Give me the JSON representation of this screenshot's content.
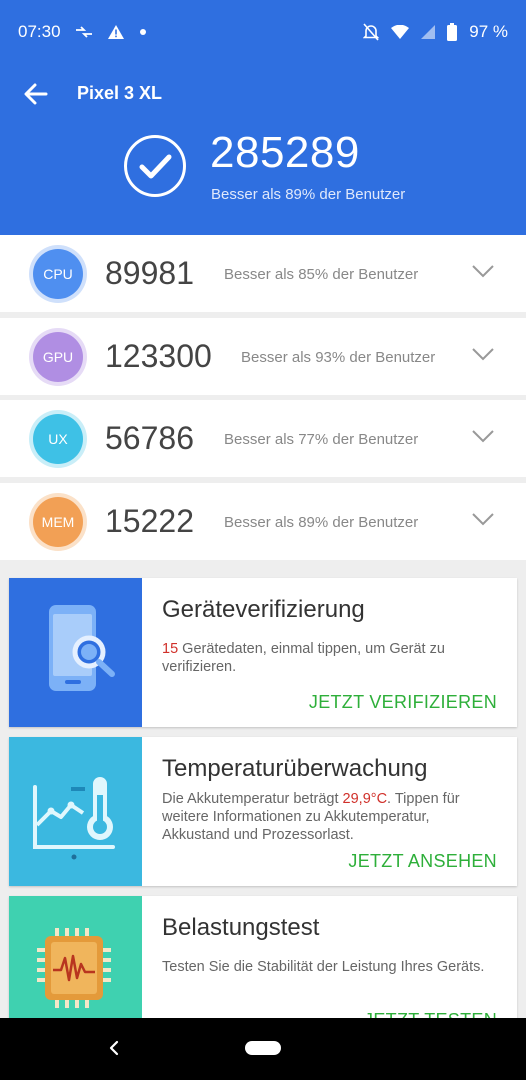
{
  "status_bar": {
    "time": "07:30",
    "battery": "97 %"
  },
  "header": {
    "device_name": "Pixel 3 XL",
    "total_score": "285289",
    "total_sub": "Besser als 89% der Benutzer"
  },
  "scores": [
    {
      "badge": "CPU",
      "score": "89981",
      "sub": "Besser als 85% der Benutzer"
    },
    {
      "badge": "GPU",
      "score": "123300",
      "sub": "Besser als 93% der Benutzer"
    },
    {
      "badge": "UX",
      "score": "56786",
      "sub": "Besser als 77% der Benutzer"
    },
    {
      "badge": "MEM",
      "score": "15222",
      "sub": "Besser als 89% der Benutzer"
    }
  ],
  "cards": [
    {
      "title": "Geräteverifizierung",
      "desc_highlight": "15",
      "desc_rest": " Gerätedaten, einmal tippen, um Gerät zu verifizieren.",
      "action": "JETZT VERIFIZIEREN",
      "icon": "phone-search-icon",
      "color": "#2f6fe0"
    },
    {
      "title": "Temperaturüberwachung",
      "desc_pre": "Die Akkutemperatur beträgt ",
      "desc_highlight": "29,9°C",
      "desc_rest": ". Tippen für weitere Informationen zu Akkutemperatur, Akkustand und Prozessorlast.",
      "action": "JETZT ANSEHEN",
      "icon": "thermometer-chart-icon",
      "color": "#3bb8e0"
    },
    {
      "title": "Belastungstest",
      "desc": "Testen Sie die Stabilität der Leistung Ihres Geräts.",
      "action": "JETZT TESTEN",
      "icon": "chip-wave-icon",
      "color": "#3fd1b0"
    }
  ],
  "colors": {
    "header_bg": "#2f6fe0",
    "action_green": "#2eaf3a",
    "highlight_red": "#d0302a"
  }
}
